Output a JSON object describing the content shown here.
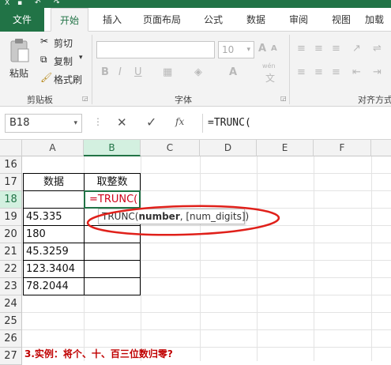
{
  "ribbon_tabs": [
    "文件",
    "开始",
    "插入",
    "页面布局",
    "公式",
    "数据",
    "审阅",
    "视图",
    "加载"
  ],
  "clipboard": {
    "paste_label": "粘贴",
    "cut_label": "剪切",
    "copy_label": "复制",
    "format_painter_label": "格式刷",
    "group_label": "剪贴板"
  },
  "font_group": {
    "font_size": "10",
    "group_label": "字体",
    "wen_label": "wén"
  },
  "align_group": {
    "group_label": "对齐方式"
  },
  "formula_bar": {
    "name_box": "B18",
    "fx_label": "fx",
    "formula": "=TRUNC("
  },
  "columns": [
    "A",
    "B",
    "C",
    "D",
    "E",
    "F"
  ],
  "rows": [
    "16",
    "17",
    "18",
    "19",
    "20",
    "21",
    "22",
    "23",
    "24",
    "25",
    "26",
    "27"
  ],
  "table": {
    "header_a": "数据",
    "header_b": "取整数",
    "editing_cell": "=TRUNC(",
    "values": [
      "45.335",
      "180",
      "45.3259",
      "123.3404",
      "78.2044"
    ]
  },
  "tooltip": {
    "func": "TRUNC(",
    "arg_bold": "number",
    "rest": ", [num_digits])"
  },
  "caption": "3.实例：将个、十、百三位数归零?",
  "colors": {
    "excel_green": "#217346",
    "annotation_red": "#e0201a",
    "caption_red": "#c00000"
  }
}
